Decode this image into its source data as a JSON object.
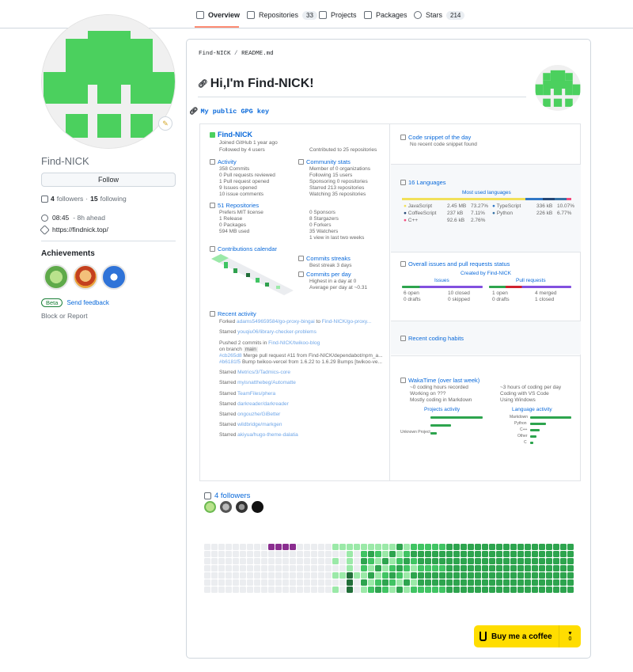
{
  "tabs": [
    {
      "label": "Overview",
      "count": "",
      "icon": "book-icon"
    },
    {
      "label": "Repositories",
      "count": "33",
      "icon": "repo-icon"
    },
    {
      "label": "Projects",
      "count": "",
      "icon": "table-icon"
    },
    {
      "label": "Packages",
      "count": "",
      "icon": "package-icon"
    },
    {
      "label": "Stars",
      "count": "214",
      "icon": "star-icon"
    }
  ],
  "profile": {
    "username": "Find-NICK",
    "follow_label": "Follow",
    "followers_count": "4",
    "followers_label": "followers",
    "following_count": "15",
    "following_label": "following",
    "dot": "·",
    "local_time": "08:45",
    "time_offset": "- 8h ahead",
    "website": "https://findnick.top/",
    "achievements_title": "Achievements",
    "beta_label": "Beta",
    "feedback_label": "Send feedback",
    "block_label": "Block or Report"
  },
  "readme": {
    "crumb_user": "Find-NICK",
    "crumb_sep": "/",
    "crumb_file": "README.md",
    "heading": "Hi,I'm Find-NICK!",
    "gpg_link": "My public GPG key"
  },
  "metrics": {
    "name": "Find-NICK",
    "joined": "Joined GitHub 1 year ago",
    "followed_by": "Followed by 4 users",
    "contributed": "Contributed to 25 repositories",
    "activity_title": "Activity",
    "activity": [
      "358 Commits",
      "0 Pull requests reviewed",
      "1 Pull request opened",
      "9 Issues opened",
      "10 issue comments"
    ],
    "community_title": "Community stats",
    "community": [
      "Member of 0 organizations",
      "Following 15 users",
      "Sponsoring 0 repositories",
      "Starred 213 repositories",
      "Watching 35 repositories"
    ],
    "repos_title": "51 Repositories",
    "repos": [
      "Prefers MIT license",
      "1 Release",
      "0 Packages",
      "594 MB used"
    ],
    "repos_right": [
      "0 Sponsors",
      "8 Stargazers",
      "0 Forkers",
      "35 Watchers",
      "1 view in last two weeks"
    ],
    "calendar_title": "Contributions calendar",
    "streaks_title": "Commits streaks",
    "streak": "Best streak 3 days",
    "perday_title": "Commits per day",
    "perday": [
      "Highest in a day at 0",
      "Average per day at ~0.31"
    ],
    "recent_title": "Recent activity",
    "recent": [
      {
        "prefix": "Forked",
        "link": "adams549659584/go-proxy-bingai",
        "mid": "to",
        "link2": "Find-NICK/go-proxy..."
      },
      {
        "prefix": "Starred",
        "link": "youqiu06/library-checker-problems",
        "mid": "",
        "link2": ""
      },
      {
        "prefix": "Pushed 2 commits in",
        "link": "Find-NICK/twikoo-blog",
        "mid": "",
        "link2": ""
      },
      {
        "prefix": "Starred",
        "link": "Metrics/3/Tadmics-core",
        "mid": "",
        "link2": ""
      },
      {
        "prefix": "Starred",
        "link": "myisnatthebeg/Automatte",
        "mid": "",
        "link2": ""
      },
      {
        "prefix": "Starred",
        "link": "TeamFiles/phera",
        "mid": "",
        "link2": ""
      },
      {
        "prefix": "Starred",
        "link": "darkreader/darkreader",
        "mid": "",
        "link2": ""
      },
      {
        "prefix": "Starred",
        "link": "ongouzhe/GiBetter",
        "mid": "",
        "link2": ""
      },
      {
        "prefix": "Starred",
        "link": "wildbridge/markgen",
        "mid": "",
        "link2": ""
      },
      {
        "prefix": "Starred",
        "link": "akiyua/hugo-theme-dalatia",
        "mid": "",
        "link2": ""
      }
    ],
    "branch_label": "on branch",
    "branch": "main",
    "commit1_sha": "#cb265d8",
    "commit1": "Merge pull request #11 from Find-NICK/dependabot/npm_a...",
    "commit2_sha": "#b6181f5",
    "commit2": "Bump twikoo-vercel from 1.6.22 to 1.6.29 Bumps [twikoo-ve...",
    "snippet_title": "Code snippet of the day",
    "snippet_text": "No recent code snippet found",
    "lang_title": "16 Languages",
    "lang_sub": "Most used languages",
    "languages": [
      {
        "name": "JavaScript",
        "size": "2.45 MB",
        "pct": "73.27%",
        "color": "#f1e05a"
      },
      {
        "name": "CoffeeScript",
        "size": "237 kB",
        "pct": "7.11%",
        "color": "#244776"
      },
      {
        "name": "C++",
        "size": "92.6 kB",
        "pct": "2.76%",
        "color": "#f34b7d"
      },
      {
        "name": "TypeScript",
        "size": "336 kB",
        "pct": "10.07%",
        "color": "#3178c6"
      },
      {
        "name": "Python",
        "size": "226 kB",
        "pct": "6.77%",
        "color": "#3572a5"
      }
    ],
    "issues_title": "Overall issues and pull requests status",
    "issues_sub": "Created by Find-NICK",
    "issues_label": "Issues",
    "prs_label": "Pull requests",
    "issues_stats": [
      "6 open",
      "10 closed",
      "0 drafts",
      "0 skipped"
    ],
    "pr_stats": [
      "1 open",
      "0 drafts",
      "4 merged",
      "1 closed"
    ],
    "coding_title": "Recent coding habits",
    "waka_title": "WakaTime (over last week)",
    "waka_left": [
      "~0 coding hours recorded",
      "Working on ???",
      "Mostly coding in Markdown"
    ],
    "waka_right": [
      "~3 hours of coding per day",
      "Coding with VS Code",
      "Using Windows"
    ],
    "proj_title": "Projects activity",
    "lang_act_title": "Language activity",
    "lang_act": [
      "Markdown",
      "Python",
      "C++",
      "Other",
      "C"
    ],
    "proj_act": [
      "Unknown Project"
    ]
  },
  "followers": {
    "title": "4 followers"
  },
  "coffee": {
    "label": "Buy me a coffee",
    "count": "0"
  }
}
